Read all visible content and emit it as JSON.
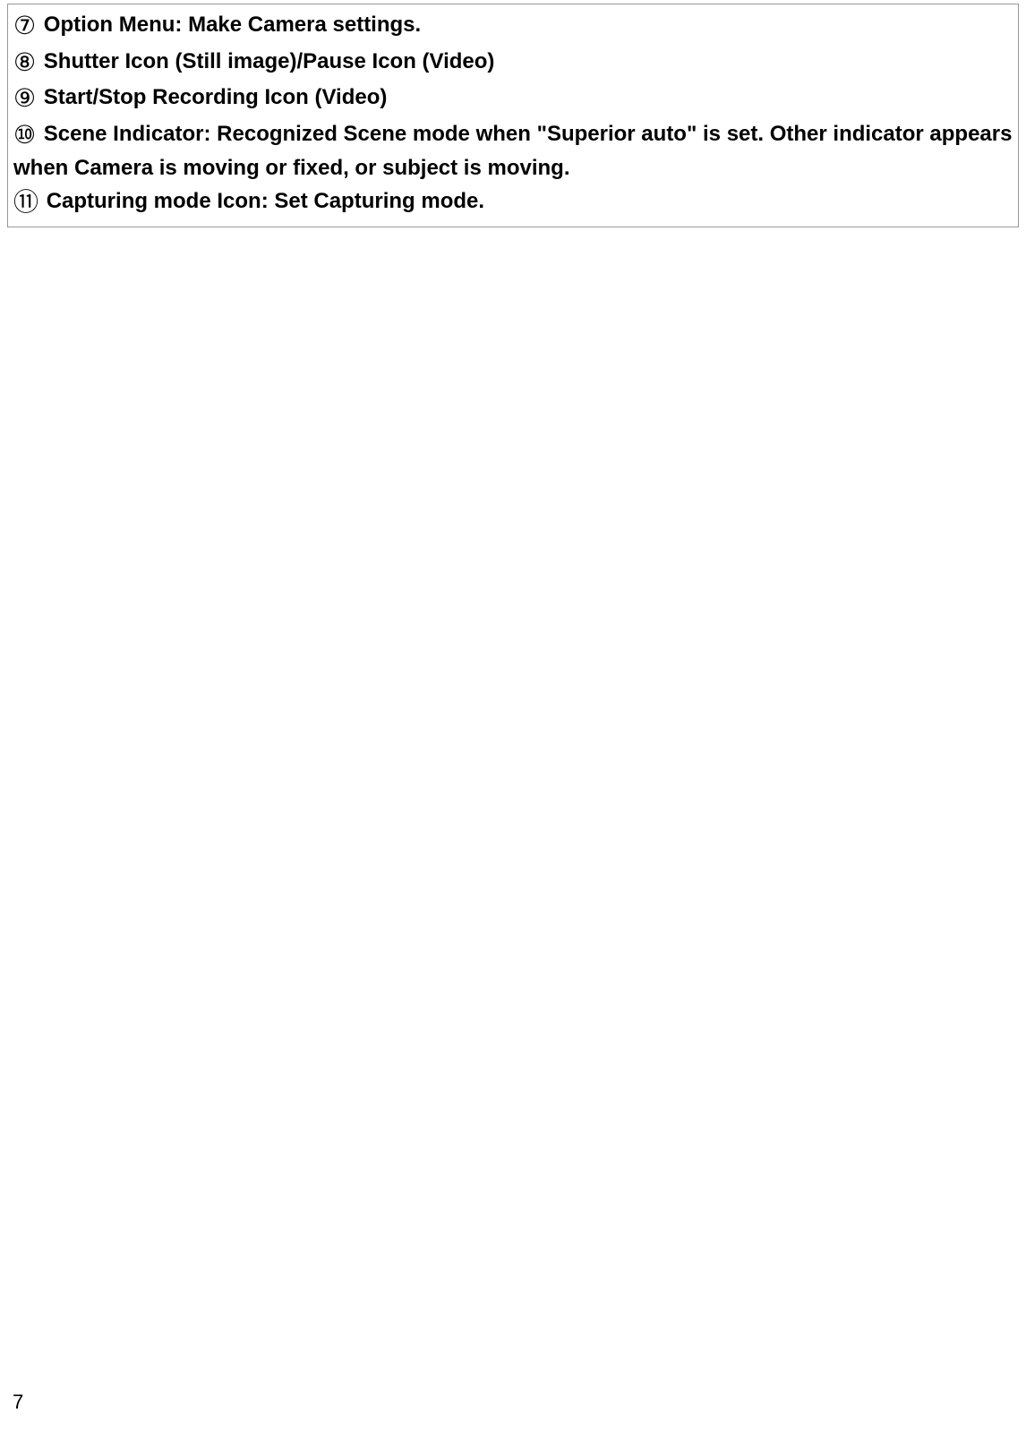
{
  "items": [
    {
      "marker": "⑦",
      "text": "Option Menu: Make Camera settings."
    },
    {
      "marker": "⑧",
      "text": "Shutter Icon (Still image)/Pause Icon (Video)"
    },
    {
      "marker": "⑨",
      "text": "Start/Stop Recording Icon (Video)"
    },
    {
      "marker": "⑩",
      "text": "Scene Indicator: Recognized Scene mode when \"Superior auto\" is set. Other indicator appears when Camera is moving or fixed, or subject is moving."
    },
    {
      "marker": "⑪",
      "text": "Capturing mode Icon: Set Capturing mode."
    }
  ],
  "page_number": "7"
}
